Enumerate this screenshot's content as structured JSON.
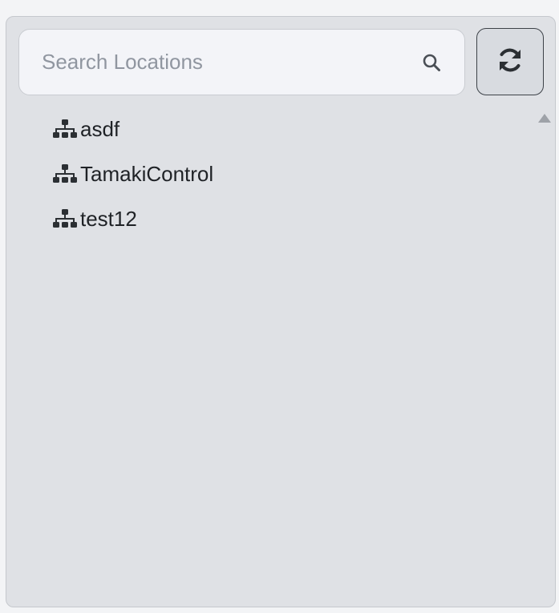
{
  "search": {
    "placeholder": "Search Locations",
    "value": "",
    "icon": "search-icon"
  },
  "refresh": {
    "icon": "refresh-icon"
  },
  "locations": [
    {
      "label": "asdf",
      "icon": "sitemap-icon"
    },
    {
      "label": "TamakiControl",
      "icon": "sitemap-icon"
    },
    {
      "label": "test12",
      "icon": "sitemap-icon"
    }
  ],
  "colors": {
    "panel_bg": "#dfe1e5",
    "input_bg": "#f3f4f8",
    "text": "#1f2226",
    "placeholder": "#9096a0",
    "icon": "#2b2f33"
  }
}
